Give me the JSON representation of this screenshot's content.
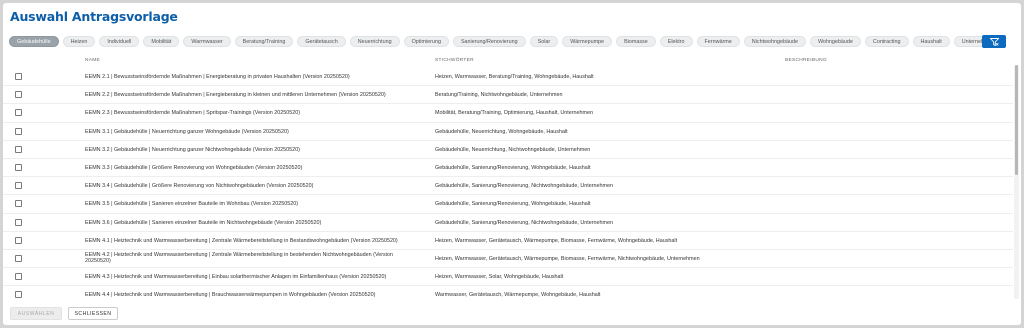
{
  "dialog": {
    "title": "Auswahl Antragsvorlage"
  },
  "filters": {
    "chips": [
      {
        "label": "Gebäudehülle",
        "active": true
      },
      {
        "label": "Heizen"
      },
      {
        "label": "Individuell"
      },
      {
        "label": "Mobilität"
      },
      {
        "label": "Warmwasser"
      },
      {
        "label": "Beratung/Training"
      },
      {
        "label": "Gerätetausch"
      },
      {
        "label": "Neuerrichtung"
      },
      {
        "label": "Optimierung"
      },
      {
        "label": "Sanierung/Renovierung"
      },
      {
        "label": "Solar"
      },
      {
        "label": "Wärmepumpe"
      },
      {
        "label": "Biomasse"
      },
      {
        "label": "Elektro"
      },
      {
        "label": "Fernwärme"
      },
      {
        "label": "Nichtwohngebäude"
      },
      {
        "label": "Wohngebäude"
      },
      {
        "label": "Contracting"
      },
      {
        "label": "Haushalt"
      },
      {
        "label": "Unternehmen"
      }
    ],
    "filter_icon": "filter-clear-icon"
  },
  "table": {
    "headers": {
      "name": "NAME",
      "keywords": "STICHWÖRTER",
      "description": "BESCHREIBUNG"
    },
    "rows": [
      {
        "name": "EEMN 2.1 | Bewusstseinsfördernde Maßnahmen | Energieberatung in privaten Haushalten (Version 20250520)",
        "tags": "Heizen, Warmwasser, Beratung/Training, Wohngebäude, Haushalt"
      },
      {
        "name": "EEMN 2.2 | Bewusstseinsfördernde Maßnahmen | Energieberatung in kleinen und mittleren Unternehmen (Version 20250520)",
        "tags": "Beratung/Training, Nichtwohngebäude, Unternehmen"
      },
      {
        "name": "EEMN 2.3 | Bewusstseinsfördernde Maßnahmen | Spritspar-Trainings (Version 20250520)",
        "tags": "Mobilität, Beratung/Training, Optimierung, Haushalt, Unternehmen"
      },
      {
        "name": "EEMN 3.1 | Gebäudehülle | Neuerrichtung ganzer Wohngebäude (Version 20250520)",
        "tags": "Gebäudehülle, Neuerrichtung, Wohngebäude, Haushalt"
      },
      {
        "name": "EEMN 3.2 | Gebäudehülle | Neuerrichtung ganzer Nichtwohngebäude (Version 20250520)",
        "tags": "Gebäudehülle, Neuerrichtung, Nichtwohngebäude, Unternehmen"
      },
      {
        "name": "EEMN 3.3 | Gebäudehülle | Größere Renovierung von Wohngebäuden (Version 20250520)",
        "tags": "Gebäudehülle, Sanierung/Renovierung, Wohngebäude, Haushalt"
      },
      {
        "name": "EEMN 3.4 | Gebäudehülle | Größere Renovierung von Nichtwohngebäuden (Version 20250520)",
        "tags": "Gebäudehülle, Sanierung/Renovierung, Nichtwohngebäude, Unternehmen"
      },
      {
        "name": "EEMN 3.5 | Gebäudehülle | Sanieren einzelner Bauteile im Wohnbau (Version 20250520)",
        "tags": "Gebäudehülle, Sanierung/Renovierung, Wohngebäude, Haushalt"
      },
      {
        "name": "EEMN 3.6 | Gebäudehülle | Sanieren einzelner Bauteile im Nichtwohngebäude (Version 20250520)",
        "tags": "Gebäudehülle, Sanierung/Renovierung, Nichtwohngebäude, Unternehmen"
      },
      {
        "name": "EEMN 4.1 | Heiztechnik und Warmwasserbereitung | Zentrale Wärmebereitstellung in Bestandswohngebäuden (Version 20250520)",
        "tags": "Heizen, Warmwasser, Gerätetausch, Wärmepumpe, Biomasse, Fernwärme, Wohngebäude, Haushalt"
      },
      {
        "name": "EEMN 4.2 | Heiztechnik und Warmwasserbereitung | Zentrale Wärmebereitstellung in bestehenden Nichtwohngebäuden (Version 20250520)",
        "tags": "Heizen, Warmwasser, Gerätetausch, Wärmepumpe, Biomasse, Fernwärme, Nichtwohngebäude, Unternehmen"
      },
      {
        "name": "EEMN 4.3 | Heiztechnik und Warmwasserbereitung | Einbau solarthermischer Anlagen im Einfamilienhaus (Version 20250520)",
        "tags": "Heizen, Warmwasser, Solar, Wohngebäude, Haushalt"
      },
      {
        "name": "EEMN 4.4 | Heiztechnik und Warmwasserbereitung | Brauchwasserwärmepumpen in Wohngebäuden (Version 20250520)",
        "tags": "Warmwasser, Gerätetausch, Wärmepumpe, Wohngebäude, Haushalt"
      }
    ]
  },
  "footer": {
    "select_label": "AUSWÄHLEN",
    "close_label": "SCHLIESSEN"
  }
}
